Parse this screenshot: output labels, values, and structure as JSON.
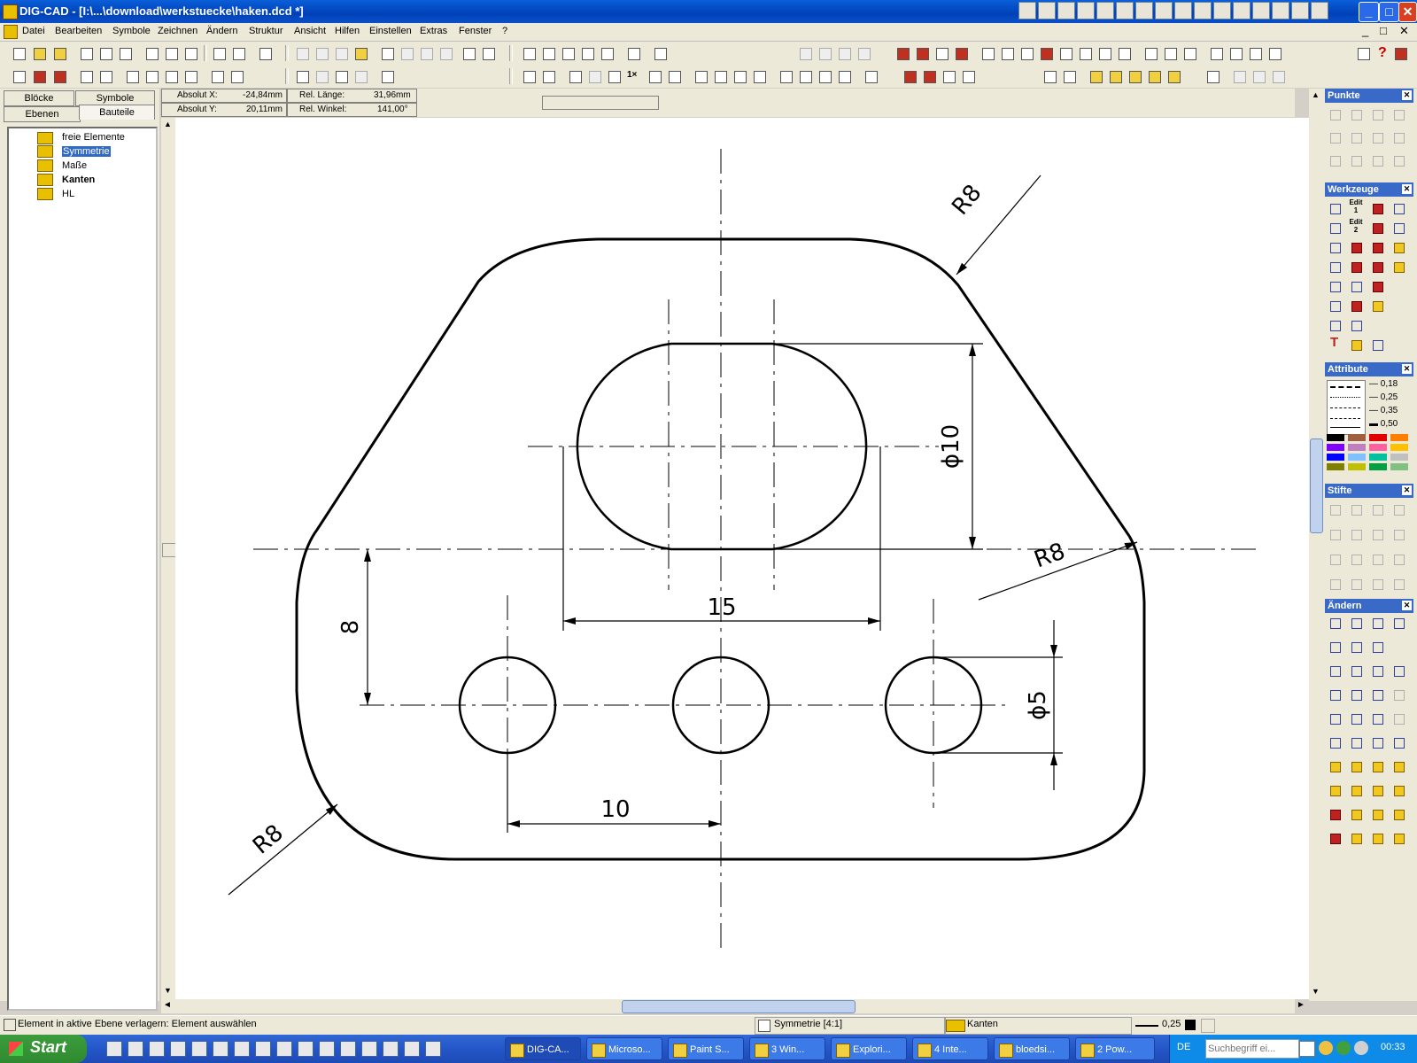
{
  "window": {
    "title": "DIG-CAD - [I:\\...\\download\\werkstuecke\\haken.dcd *]",
    "buttons": {
      "minimize": "_",
      "maximize": "□",
      "close": "✕"
    }
  },
  "menu": [
    "Datei",
    "Bearbeiten",
    "Symbole",
    "Zeichnen",
    "Ändern",
    "Struktur",
    "Ansicht",
    "Hilfen",
    "Einstellen",
    "Extras",
    "Fenster",
    "?"
  ],
  "left_tabs": {
    "top": [
      "Blöcke",
      "Symbole"
    ],
    "bottom": [
      "Ebenen",
      "Bauteile"
    ]
  },
  "tree": [
    {
      "label": "freie Elemente",
      "selected": false,
      "bold": false
    },
    {
      "label": "Symmetrie",
      "selected": true,
      "bold": false
    },
    {
      "label": "Maße",
      "selected": false,
      "bold": false
    },
    {
      "label": "Kanten",
      "selected": false,
      "bold": true
    },
    {
      "label": "HL",
      "selected": false,
      "bold": false
    }
  ],
  "coords": {
    "abs_x_label": "Absolut X:",
    "abs_x": "-24,84mm",
    "abs_y_label": "Absolut Y:",
    "abs_y": "20,11mm",
    "rel_len_label": "Rel. Länge:",
    "rel_len": "31,96mm",
    "rel_ang_label": "Rel. Winkel:",
    "rel_ang": "141,00°"
  },
  "drawing": {
    "dims": {
      "r_top": "R8",
      "r_right": "R8",
      "r_bottom": "R8",
      "d10": "ϕ10",
      "d5": "ϕ5",
      "w15": "15",
      "h8": "8",
      "w10": "10"
    }
  },
  "right_panels": [
    "Punkte",
    "Werkzeuge",
    "Attribute",
    "Stifte",
    "Ändern"
  ],
  "line_widths": [
    "0,18",
    "0,25",
    "0,35",
    "0,50"
  ],
  "tool_labels": {
    "edit1": "Edit 1",
    "edit2": "Edit 2"
  },
  "status": {
    "message": "Element in aktive Ebene verlagern: Element auswählen",
    "symmetry": "Symmetrie [4:1]",
    "layer": "Kanten",
    "linewidth": "0,25"
  },
  "taskbar": {
    "start": "Start",
    "tasks": [
      "DIG-CA...",
      "Microso...",
      "Paint S...",
      "3 Win...",
      "Explori...",
      "4 Inte...",
      "bloedsi...",
      "2 Pow..."
    ],
    "lang": "DE",
    "search_placeholder": "Suchbegriff ei...",
    "clock": "00:33"
  },
  "colors": {
    "title_blue": "#0041b8",
    "panel_header": "#3a6ac8",
    "swatches": [
      "#000000",
      "#a06040",
      "#e00000",
      "#ff8000",
      "#8000ff",
      "#c080c0",
      "#ff60a0",
      "#ffc000",
      "#0000ff",
      "#80c0ff",
      "#00c0a0",
      "#c0c0c0",
      "#808000",
      "#c0c000",
      "#00a040",
      "#80c080"
    ]
  }
}
